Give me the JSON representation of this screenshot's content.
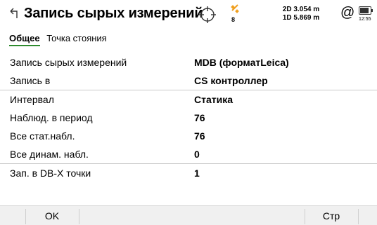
{
  "header": {
    "title": "Запись сырых измерений",
    "satellite_count": "8",
    "quality_2d": "2D 3.054 m",
    "quality_1d": "1D 5.869 m",
    "at_symbol": "@",
    "battery_time": "12:55",
    "icons": [
      "back-arrow-icon",
      "target-icon",
      "satellite-icon",
      "at-icon",
      "battery-icon"
    ]
  },
  "tabs": [
    {
      "label": "Общее",
      "active": true
    },
    {
      "label": "Точка стояния",
      "active": false
    }
  ],
  "rows": [
    {
      "label": "Запись сырых измерений",
      "value": "MDB (форматLeica)"
    },
    {
      "label": "Запись в",
      "value": "CS контроллер"
    },
    {
      "label": "Интервал",
      "value": "Статика"
    },
    {
      "label": "Наблюд. в период",
      "value": "76"
    },
    {
      "label": "Все стат.набл.",
      "value": "76"
    },
    {
      "label": "Все динам. набл.",
      "value": "0"
    },
    {
      "label": "Зап. в DB-X точки",
      "value": "1"
    }
  ],
  "footer": {
    "ok_label": "OK",
    "page_label": "Стр"
  },
  "colors": {
    "accent_green": "#2e8b2e",
    "satellite_orange": "#f0a020"
  }
}
